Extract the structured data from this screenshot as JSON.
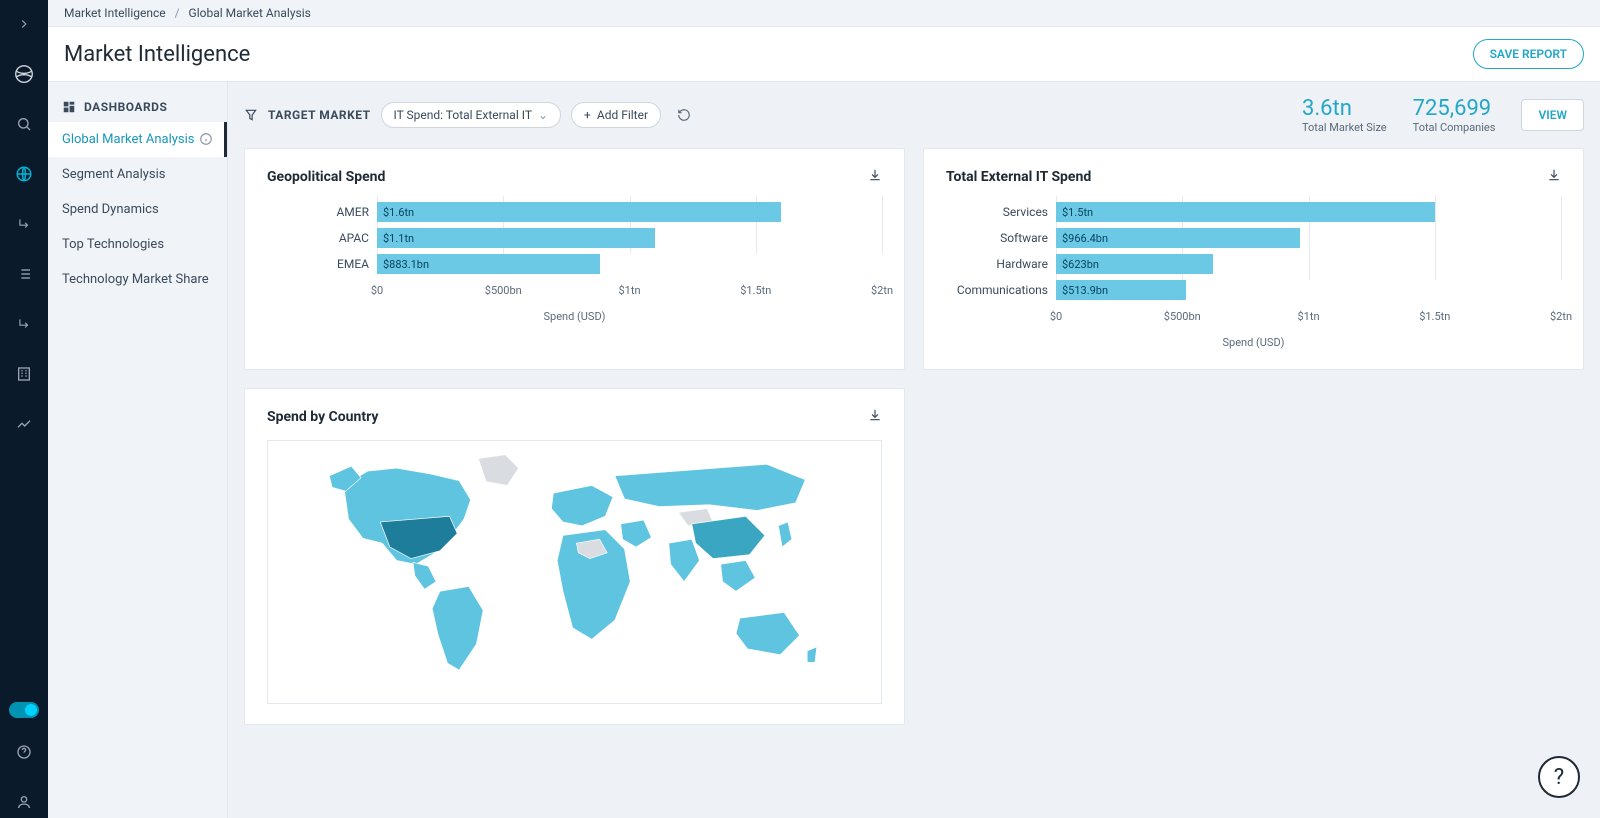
{
  "breadcrumb": {
    "parent": "Market Intelligence",
    "current": "Global Market Analysis"
  },
  "page_title": "Market Intelligence",
  "save_report_label": "SAVE REPORT",
  "sidebar": {
    "header": "DASHBOARDS",
    "items": [
      {
        "label": "Global Market Analysis",
        "active": true,
        "has_info": true
      },
      {
        "label": "Segment Analysis"
      },
      {
        "label": "Spend Dynamics"
      },
      {
        "label": "Top Technologies"
      },
      {
        "label": "Technology Market Share"
      }
    ]
  },
  "filters": {
    "target_label": "TARGET MARKET",
    "target_pill": "IT Spend: Total External IT",
    "add_filter_label": "Add Filter"
  },
  "metrics": {
    "market_size": {
      "value": "3.6tn",
      "label": "Total Market Size"
    },
    "companies": {
      "value": "725,699",
      "label": "Total Companies"
    }
  },
  "view_btn_label": "VIEW",
  "cards": {
    "geo": {
      "title": "Geopolitical Spend",
      "xlabel": "Spend (USD)"
    },
    "it": {
      "title": "Total External IT Spend",
      "xlabel": "Spend (USD)"
    },
    "map": {
      "title": "Spend by Country"
    }
  },
  "chart_data": [
    {
      "id": "geo",
      "type": "bar",
      "orientation": "horizontal",
      "categories": [
        "AMER",
        "APAC",
        "EMEA"
      ],
      "values_tn": [
        1.6,
        1.1,
        0.8831
      ],
      "value_labels": [
        "$1.6tn",
        "$1.1tn",
        "$883.1bn"
      ],
      "xlim_tn": [
        0,
        2.0
      ],
      "ticks_tn": [
        0,
        0.5,
        1.0,
        1.5,
        2.0
      ],
      "tick_labels": [
        "$0",
        "$500bn",
        "$1tn",
        "$1.5tn",
        "$2tn"
      ],
      "xlabel": "Spend (USD)"
    },
    {
      "id": "it",
      "type": "bar",
      "orientation": "horizontal",
      "categories": [
        "Services",
        "Software",
        "Hardware",
        "Communications"
      ],
      "values_tn": [
        1.5,
        0.9664,
        0.623,
        0.5139
      ],
      "value_labels": [
        "$1.5tn",
        "$966.4bn",
        "$623bn",
        "$513.9bn"
      ],
      "xlim_tn": [
        0,
        2.0
      ],
      "ticks_tn": [
        0,
        0.5,
        1.0,
        1.5,
        2.0
      ],
      "tick_labels": [
        "$0",
        "$500bn",
        "$1tn",
        "$1.5tn",
        "$2tn"
      ],
      "xlabel": "Spend (USD)"
    },
    {
      "id": "map",
      "type": "map",
      "note": "World choropleth — USA highest spend; darker = higher spend"
    }
  ],
  "colors": {
    "accent": "#22a7c9",
    "bar_fill": "#6cc9e5",
    "nav_bg": "#0b1a2b"
  }
}
